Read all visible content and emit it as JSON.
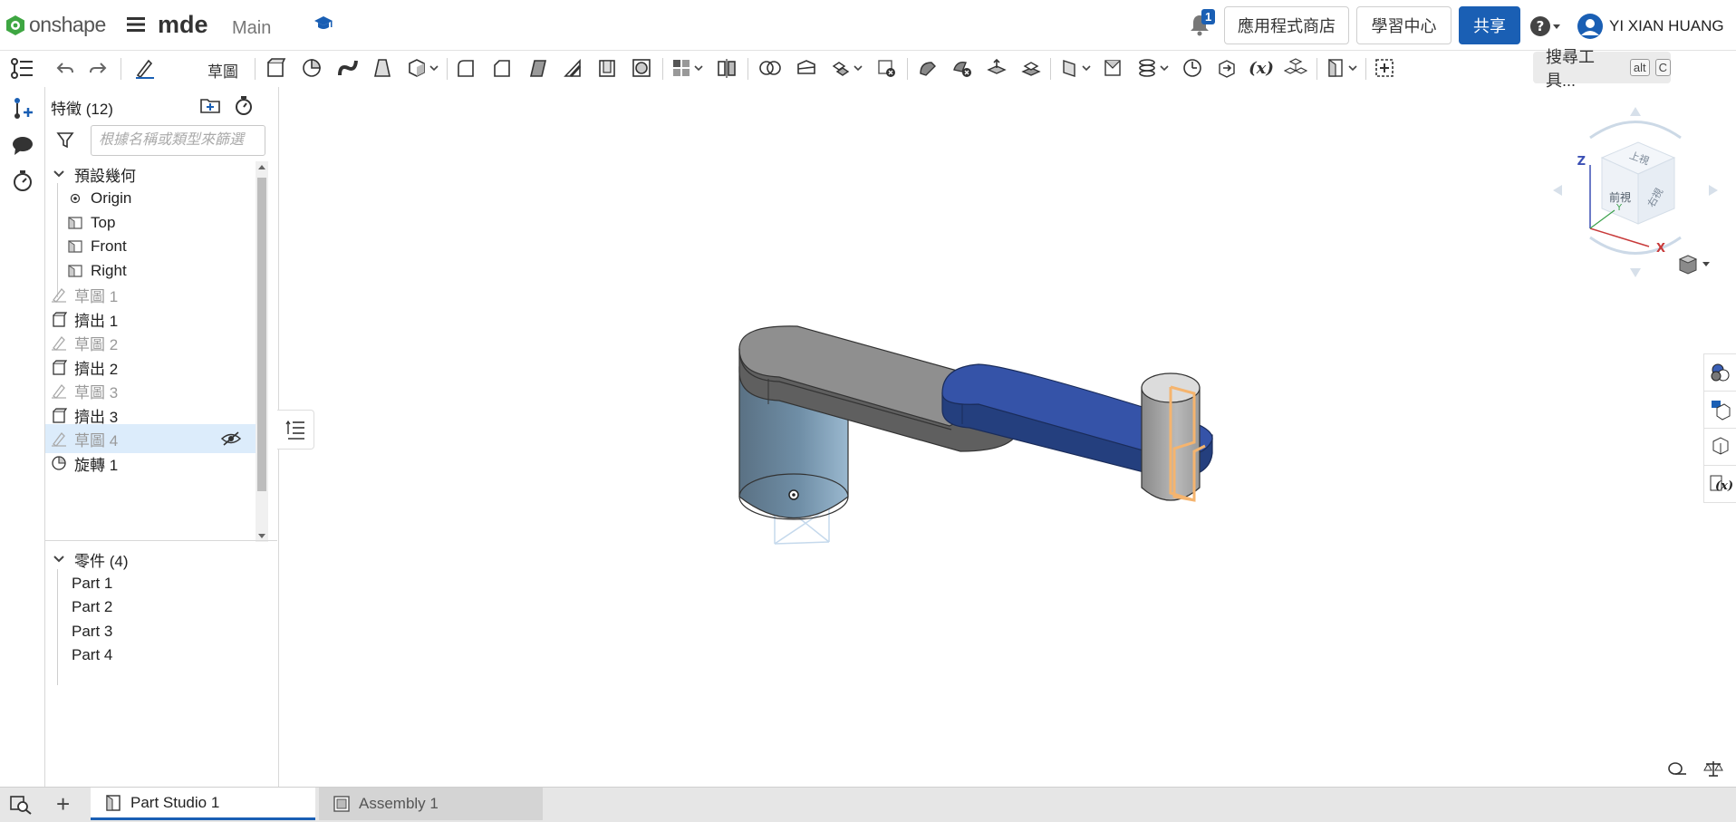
{
  "header": {
    "logo_text": "onshape",
    "doc_name": "mde",
    "branch": "Main",
    "notification_count": "1",
    "app_store": "應用程式商店",
    "learning_center": "學習中心",
    "share": "共享",
    "username": "YI XIAN HUANG"
  },
  "toolbar": {
    "sketch_label": "草圖",
    "search_tools": "搜尋工具...",
    "search_kbd1": "alt",
    "search_kbd2": "C"
  },
  "feature_panel": {
    "header": "特徵 (12)",
    "filter_placeholder": "根據名稱或類型來篩選",
    "default_geometry": "預設幾何",
    "geometry": [
      "Origin",
      "Top",
      "Front",
      "Right"
    ],
    "features": [
      {
        "label": "草圖 1",
        "type": "sketch"
      },
      {
        "label": "擠出 1",
        "type": "extrude"
      },
      {
        "label": "草圖 2",
        "type": "sketch"
      },
      {
        "label": "擠出 2",
        "type": "extrude"
      },
      {
        "label": "草圖 3",
        "type": "sketch"
      },
      {
        "label": "擠出 3",
        "type": "extrude"
      },
      {
        "label": "草圖 4",
        "type": "sketch"
      },
      {
        "label": "旋轉 1",
        "type": "revolve"
      }
    ],
    "parts_header": "零件 (4)",
    "parts": [
      "Part 1",
      "Part 2",
      "Part 3",
      "Part 4"
    ]
  },
  "viewcube": {
    "top": "上視",
    "front": "前視",
    "right": "右視",
    "axis_x": "X",
    "axis_y": "Y",
    "axis_z": "Z"
  },
  "tabs": {
    "part_studio": "Part Studio 1",
    "assembly": "Assembly 1"
  },
  "colors": {
    "accent": "#1a5fb4",
    "selected_row": "#dcecfb",
    "part_blue": "#2f4fa3",
    "sketch_orange": "#f5b46e"
  }
}
